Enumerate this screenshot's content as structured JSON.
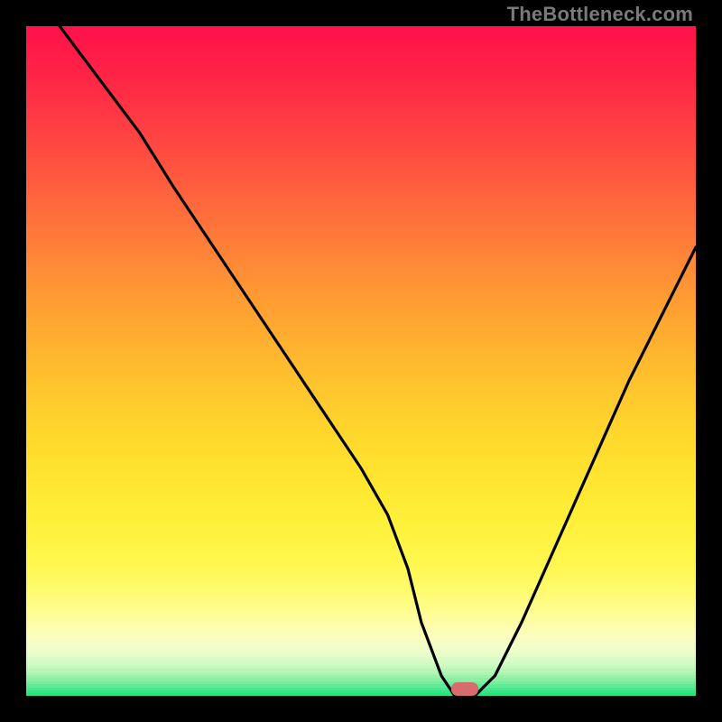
{
  "attribution": "TheBottleneck.com",
  "gradient_stops": [
    {
      "p": 0.0,
      "c": "#ff1249"
    },
    {
      "p": 0.06,
      "c": "#ff2147"
    },
    {
      "p": 0.12,
      "c": "#ff3544"
    },
    {
      "p": 0.18,
      "c": "#ff4a41"
    },
    {
      "p": 0.24,
      "c": "#ff603e"
    },
    {
      "p": 0.3,
      "c": "#ff763a"
    },
    {
      "p": 0.36,
      "c": "#ff8c36"
    },
    {
      "p": 0.42,
      "c": "#ffa132"
    },
    {
      "p": 0.48,
      "c": "#ffb42f"
    },
    {
      "p": 0.54,
      "c": "#ffc62d"
    },
    {
      "p": 0.6,
      "c": "#ffd52c"
    },
    {
      "p": 0.65,
      "c": "#ffe12e"
    },
    {
      "p": 0.7,
      "c": "#ffea33"
    },
    {
      "p": 0.75,
      "c": "#fff23d"
    },
    {
      "p": 0.8,
      "c": "#fff74f"
    },
    {
      "p": 0.84,
      "c": "#fffb6e"
    },
    {
      "p": 0.875,
      "c": "#fffd96"
    },
    {
      "p": 0.905,
      "c": "#fcfdbb"
    },
    {
      "p": 0.93,
      "c": "#eefdcd"
    },
    {
      "p": 0.95,
      "c": "#d0fac1"
    },
    {
      "p": 0.965,
      "c": "#a6f4ae"
    },
    {
      "p": 0.978,
      "c": "#72ec9c"
    },
    {
      "p": 0.99,
      "c": "#37e689"
    },
    {
      "p": 1.0,
      "c": "#14e07e"
    }
  ],
  "chart_data": {
    "type": "line",
    "title": "",
    "xlabel": "",
    "ylabel": "",
    "xlim": [
      0,
      100
    ],
    "ylim": [
      0,
      100
    ],
    "series": [
      {
        "name": "bottleneck-curve",
        "x": [
          5,
          11,
          17,
          22,
          26,
          30,
          34,
          38,
          42,
          46,
          50,
          54,
          57,
          59,
          62,
          64,
          67,
          70,
          74,
          78,
          82,
          86,
          90,
          94,
          98,
          100
        ],
        "y": [
          100,
          92,
          84,
          76,
          70,
          64,
          58,
          52,
          46,
          40,
          34,
          27,
          19,
          11,
          3,
          0,
          0,
          3,
          11,
          20,
          29,
          38,
          47,
          55,
          63,
          67
        ]
      }
    ],
    "marker": {
      "x": 65.5,
      "y": 0,
      "w": 4.0,
      "h": 2.0
    }
  }
}
